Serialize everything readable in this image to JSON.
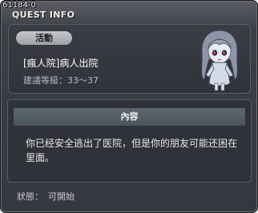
{
  "window": {
    "id": "61184-0",
    "title": "QUEST INFO"
  },
  "quest": {
    "category": "活動",
    "name": "[瘋人院]病人出院",
    "level_label": "建議等級：33～37"
  },
  "content": {
    "header": "內容",
    "text": "你已经安全逃出了医院，但是你的朋友可能还困在里面。"
  },
  "status": {
    "label": "狀態：",
    "value": "可開始"
  },
  "npc": {
    "icon": "ghost-girl-npc-icon"
  },
  "colors": {
    "panel_bg": "#35383f",
    "header_bg": "#55616a",
    "tag_bg": "#b3b5b9"
  }
}
